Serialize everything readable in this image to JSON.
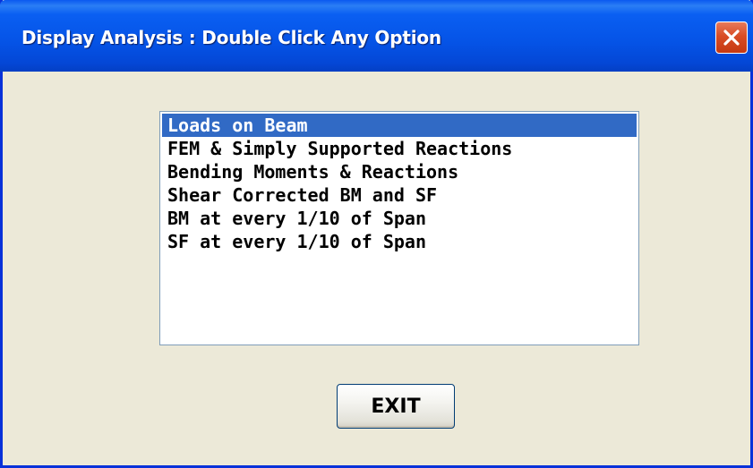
{
  "window": {
    "title": "Display Analysis : Double Click Any Option",
    "close_icon": "close-x-icon"
  },
  "options": {
    "items": [
      "Loads on Beam",
      "FEM & Simply Supported Reactions",
      "Bending Moments & Reactions",
      "Shear Corrected BM and SF",
      "BM at every 1/10 of Span",
      "SF at every 1/10 of Span"
    ],
    "selected_index": 0
  },
  "buttons": {
    "exit_label": "EXIT"
  },
  "colors": {
    "titlebar": "#0553e6",
    "window_background": "#ece9d8",
    "selection": "#316ac5",
    "close_button": "#d84c25"
  }
}
